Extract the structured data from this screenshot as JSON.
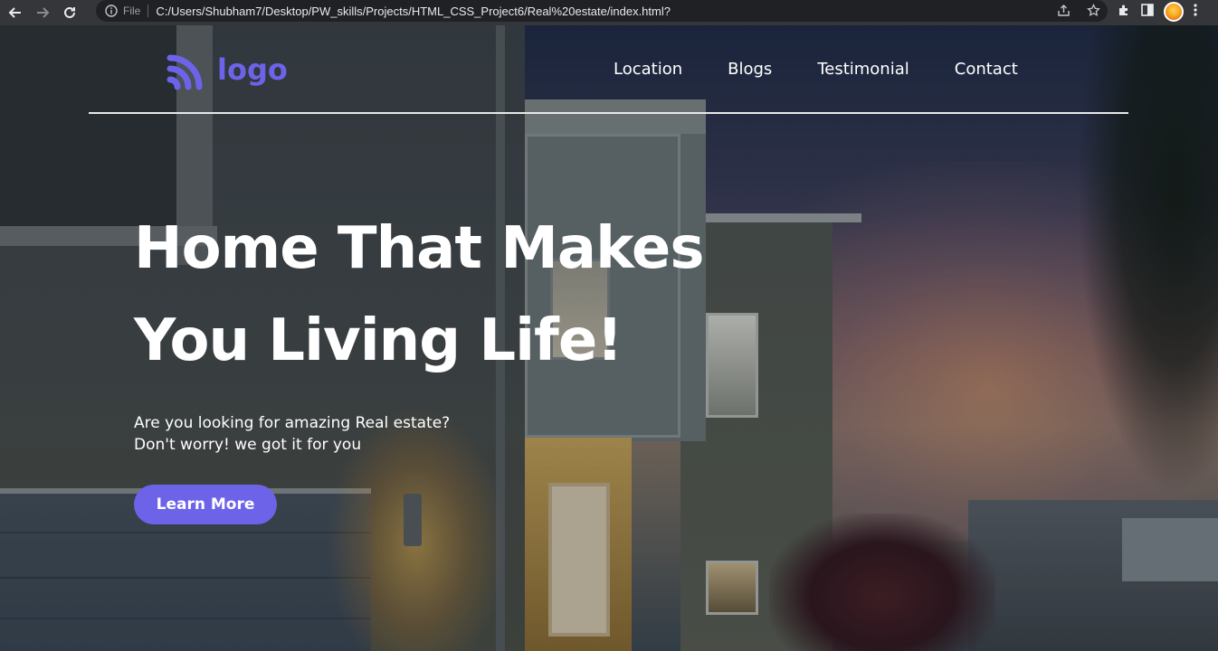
{
  "browser": {
    "file_label": "File",
    "url": "C:/Users/Shubham7/Desktop/PW_skills/Projects/HTML_CSS_Project6/Real%20estate/index.html?",
    "icons": [
      "back-arrow-icon",
      "forward-arrow-icon",
      "reload-icon",
      "info-icon",
      "share-icon",
      "star-icon",
      "extensions-icon",
      "side-panel-icon",
      "avatar",
      "menu-dots-icon"
    ]
  },
  "header": {
    "logo_text": "logo",
    "nav": [
      "Location",
      "Blogs",
      "Testimonial",
      "Contact"
    ]
  },
  "hero": {
    "line1": "Home That Makes",
    "line2": "You Living Life!",
    "subtitle": "Are you looking for amazing Real estate? Don't worry! we got it for you",
    "cta_label": "Learn More"
  },
  "colors": {
    "accent": "#6c63e8",
    "text": "#ffffff",
    "chrome_bg": "#35363a",
    "omnibox_bg": "#202124"
  }
}
